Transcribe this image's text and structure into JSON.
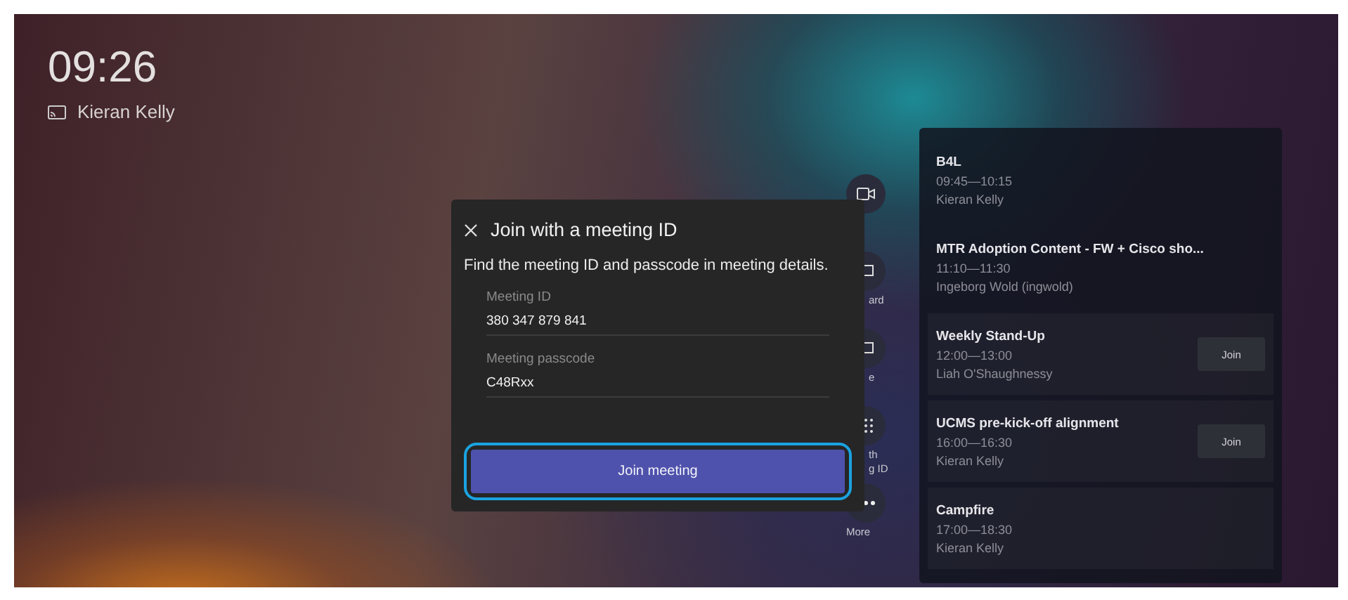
{
  "home": {
    "time": "09:26",
    "room": "Kieran Kelly"
  },
  "rail": [
    {
      "kind": "video"
    },
    {
      "kind": "screen",
      "label": "ard"
    },
    {
      "kind": "screen",
      "label": "e"
    },
    {
      "kind": "dialpad",
      "label": "th\ng ID"
    },
    {
      "kind": "more",
      "label": "More"
    }
  ],
  "dialog": {
    "title": "Join with a meeting ID",
    "description": "Find the meeting ID and passcode in meeting details.",
    "fields": [
      {
        "label": "Meeting ID",
        "value": "380 347 879 841"
      },
      {
        "label": "Meeting passcode",
        "value": "C48Rxx"
      }
    ],
    "button": {
      "label": "Join meeting",
      "focused": true
    }
  },
  "agenda": [
    {
      "title": "B4L",
      "time": "09:45—10:15",
      "organizer": "Kieran Kelly"
    },
    {
      "title": "MTR Adoption Content - FW + Cisco sho...",
      "time": "11:10—11:30",
      "organizer": "Ingeborg Wold (ingwold)"
    },
    {
      "title": "Weekly Stand-Up",
      "time": "12:00—13:00",
      "organizer": "Liah O'Shaughnessy",
      "join": "Join"
    },
    {
      "title": "UCMS pre-kick-off alignment",
      "time": "16:00—16:30",
      "organizer": "Kieran Kelly",
      "join": "Join"
    },
    {
      "title": "Campfire",
      "time": "17:00—18:30",
      "organizer": "Kieran Kelly"
    }
  ]
}
